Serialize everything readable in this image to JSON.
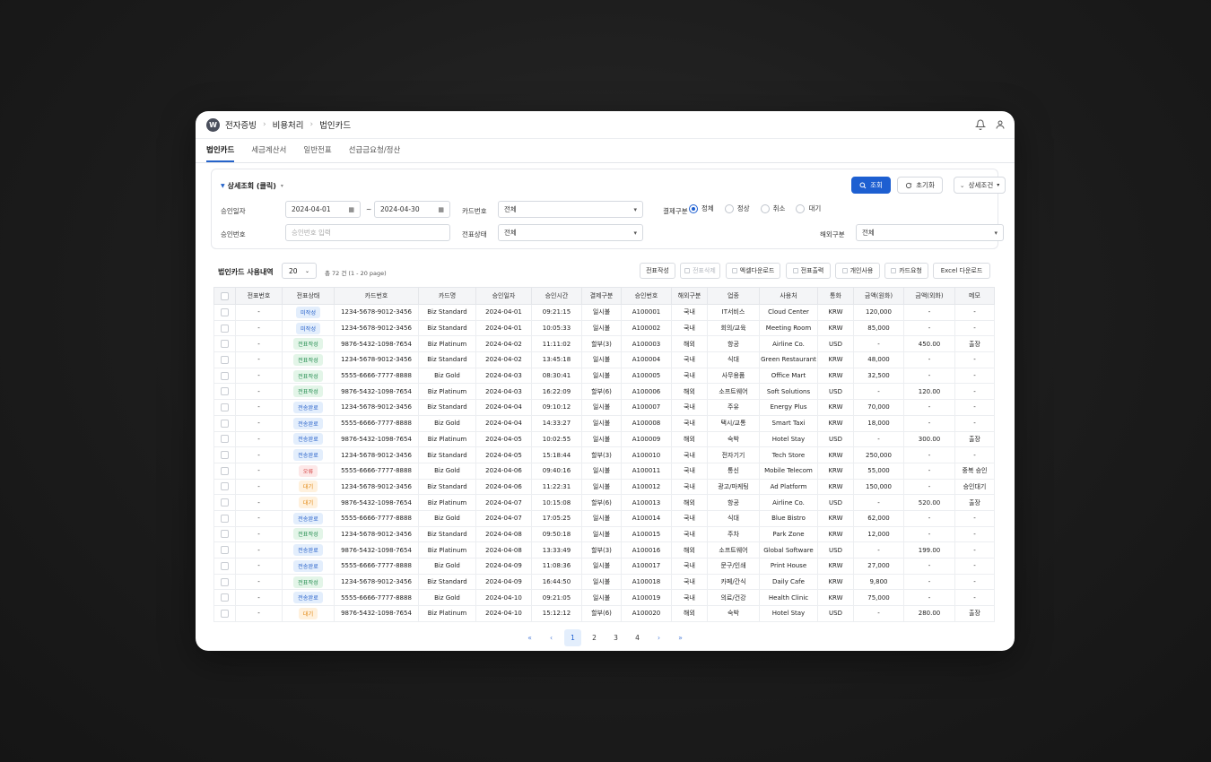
{
  "header": {
    "logo_letter": "W",
    "breadcrumb": [
      "전자증빙",
      "비용처리",
      "법인카드"
    ]
  },
  "tabs": [
    "법인카드",
    "세금계산서",
    "일반전표",
    "선급금요청/정산"
  ],
  "filter": {
    "title": "상세조회 (클릭)",
    "search_label": "조회",
    "reset_label": "초기화",
    "detail_label": "상세조건",
    "approval_date_label": "승인일자",
    "date_from": "2024-04-01",
    "date_sep": "~",
    "date_to": "2024-04-30",
    "card_no_label": "카드번호",
    "card_no_value": "전체",
    "pay_type_label": "결제구분",
    "pay_options": [
      "정체",
      "정상",
      "취소",
      "대기"
    ],
    "approval_no_label": "승인번호",
    "approval_no_placeholder": "승인번호 입력",
    "slip_status_label": "전표상태",
    "slip_status_value": "전체",
    "overseas_label": "해외구분",
    "overseas_value": "전체"
  },
  "list": {
    "title": "법인카드 사용내역",
    "page_size": "20",
    "total": "총 72 건 (1 - 20 page)",
    "actions": [
      "전표작성",
      "전표삭제",
      "엑셀다운로드",
      "전표출력",
      "개인사용",
      "카드요청",
      "Excel 다운로드"
    ]
  },
  "table": {
    "headers": [
      "",
      "전표번호",
      "전표상태",
      "카드번호",
      "카드명",
      "승인일자",
      "승인시간",
      "결제구분",
      "승인번호",
      "해외구분",
      "업종",
      "사용처",
      "통화",
      "금액(원화)",
      "금액(외화)",
      "메모"
    ],
    "rows": [
      [
        "-",
        "미작성",
        "1234-5678-9012-3456",
        "Biz Standard",
        "2024-04-01",
        "09:21:15",
        "일시불",
        "A100001",
        "국내",
        "IT서비스",
        "Cloud Center",
        "KRW",
        "120,000",
        "-",
        "-"
      ],
      [
        "-",
        "미작성",
        "1234-5678-9012-3456",
        "Biz Standard",
        "2024-04-01",
        "10:05:33",
        "일시불",
        "A100002",
        "국내",
        "회의/교육",
        "Meeting Room",
        "KRW",
        "85,000",
        "-",
        "-"
      ],
      [
        "-",
        "전표작성",
        "9876-5432-1098-7654",
        "Biz Platinum",
        "2024-04-02",
        "11:11:02",
        "할부(3)",
        "A100003",
        "해외",
        "항공",
        "Airline Co.",
        "USD",
        "-",
        "450.00",
        "출장"
      ],
      [
        "-",
        "전표작성",
        "1234-5678-9012-3456",
        "Biz Standard",
        "2024-04-02",
        "13:45:18",
        "일시불",
        "A100004",
        "국내",
        "식대",
        "Green Restaurant",
        "KRW",
        "48,000",
        "-",
        "-"
      ],
      [
        "-",
        "전표작성",
        "5555-6666-7777-8888",
        "Biz Gold",
        "2024-04-03",
        "08:30:41",
        "일시불",
        "A100005",
        "국내",
        "사무용품",
        "Office Mart",
        "KRW",
        "32,500",
        "-",
        "-"
      ],
      [
        "-",
        "전표작성",
        "9876-5432-1098-7654",
        "Biz Platinum",
        "2024-04-03",
        "16:22:09",
        "할부(6)",
        "A100006",
        "해외",
        "소프트웨어",
        "Soft Solutions",
        "USD",
        "-",
        "120.00",
        "-"
      ],
      [
        "-",
        "전송완료",
        "1234-5678-9012-3456",
        "Biz Standard",
        "2024-04-04",
        "09:10:12",
        "일시불",
        "A100007",
        "국내",
        "주유",
        "Energy Plus",
        "KRW",
        "70,000",
        "-",
        "-"
      ],
      [
        "-",
        "전송완료",
        "5555-6666-7777-8888",
        "Biz Gold",
        "2024-04-04",
        "14:33:27",
        "일시불",
        "A100008",
        "국내",
        "택시/교통",
        "Smart Taxi",
        "KRW",
        "18,000",
        "-",
        "-"
      ],
      [
        "-",
        "전송완료",
        "9876-5432-1098-7654",
        "Biz Platinum",
        "2024-04-05",
        "10:02:55",
        "일시불",
        "A100009",
        "해외",
        "숙박",
        "Hotel Stay",
        "USD",
        "-",
        "300.00",
        "출장"
      ],
      [
        "-",
        "전송완료",
        "1234-5678-9012-3456",
        "Biz Standard",
        "2024-04-05",
        "15:18:44",
        "할부(3)",
        "A100010",
        "국내",
        "전자기기",
        "Tech Store",
        "KRW",
        "250,000",
        "-",
        "-"
      ],
      [
        "-",
        "오류",
        "5555-6666-7777-8888",
        "Biz Gold",
        "2024-04-06",
        "09:40:16",
        "일시불",
        "A100011",
        "국내",
        "통신",
        "Mobile Telecom",
        "KRW",
        "55,000",
        "-",
        "중복 승인"
      ],
      [
        "-",
        "대기",
        "1234-5678-9012-3456",
        "Biz Standard",
        "2024-04-06",
        "11:22:31",
        "일시불",
        "A100012",
        "국내",
        "광고/마케팅",
        "Ad Platform",
        "KRW",
        "150,000",
        "-",
        "승인대기"
      ],
      [
        "-",
        "대기",
        "9876-5432-1098-7654",
        "Biz Platinum",
        "2024-04-07",
        "10:15:08",
        "할부(6)",
        "A100013",
        "해외",
        "항공",
        "Airline Co.",
        "USD",
        "-",
        "520.00",
        "출장"
      ],
      [
        "-",
        "전송완료",
        "5555-6666-7777-8888",
        "Biz Gold",
        "2024-04-07",
        "17:05:25",
        "일시불",
        "A100014",
        "국내",
        "식대",
        "Blue Bistro",
        "KRW",
        "62,000",
        "-",
        "-"
      ],
      [
        "-",
        "전표작성",
        "1234-5678-9012-3456",
        "Biz Standard",
        "2024-04-08",
        "09:50:18",
        "일시불",
        "A100015",
        "국내",
        "주차",
        "Park Zone",
        "KRW",
        "12,000",
        "-",
        "-"
      ],
      [
        "-",
        "전송완료",
        "9876-5432-1098-7654",
        "Biz Platinum",
        "2024-04-08",
        "13:33:49",
        "할부(3)",
        "A100016",
        "해외",
        "소프트웨어",
        "Global Software",
        "USD",
        "-",
        "199.00",
        "-"
      ],
      [
        "-",
        "전송완료",
        "5555-6666-7777-8888",
        "Biz Gold",
        "2024-04-09",
        "11:08:36",
        "일시불",
        "A100017",
        "국내",
        "문구/인쇄",
        "Print House",
        "KRW",
        "27,000",
        "-",
        "-"
      ],
      [
        "-",
        "전표작성",
        "1234-5678-9012-3456",
        "Biz Standard",
        "2024-04-09",
        "16:44:50",
        "일시불",
        "A100018",
        "국내",
        "카페/간식",
        "Daily Cafe",
        "KRW",
        "9,800",
        "-",
        "-"
      ],
      [
        "-",
        "전송완료",
        "5555-6666-7777-8888",
        "Biz Gold",
        "2024-04-10",
        "09:21:05",
        "일시불",
        "A100019",
        "국내",
        "의료/건강",
        "Health Clinic",
        "KRW",
        "75,000",
        "-",
        "-"
      ],
      [
        "-",
        "대기",
        "9876-5432-1098-7654",
        "Biz Platinum",
        "2024-04-10",
        "15:12:12",
        "할부(6)",
        "A100020",
        "해외",
        "숙박",
        "Hotel Stay",
        "USD",
        "-",
        "280.00",
        "출장"
      ]
    ]
  },
  "status_colors": {
    "미작성": "blue",
    "전표작성": "green",
    "전송완료": "blue",
    "오류": "red",
    "대기": "orange"
  },
  "pager": {
    "first": "«",
    "prev": "‹",
    "pages": [
      "1",
      "2",
      "3",
      "4"
    ],
    "current": "1",
    "next": "›",
    "last": "»"
  },
  "colors": {
    "accent": "#1d5fd1"
  }
}
